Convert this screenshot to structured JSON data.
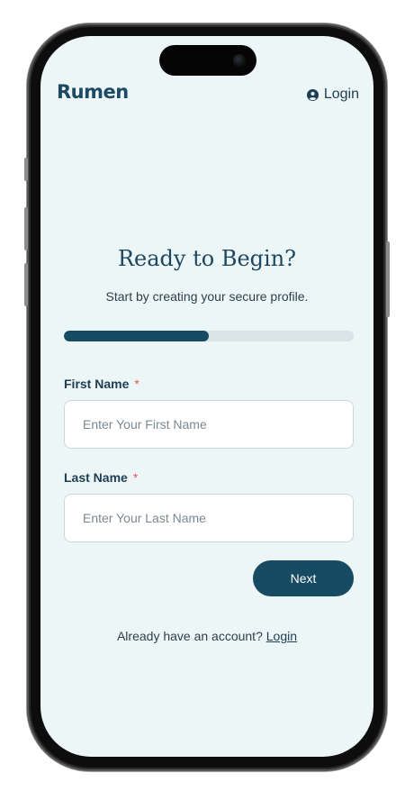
{
  "brand": {
    "logo_text": "Rumen"
  },
  "header": {
    "login_label": "Login"
  },
  "hero": {
    "title": "Ready to Begin?",
    "subtitle": "Start by creating your secure profile."
  },
  "progress": {
    "fraction": 0.5
  },
  "form": {
    "first_name": {
      "label": "First Name",
      "required_mark": "*",
      "placeholder": "Enter Your First Name",
      "value": ""
    },
    "last_name": {
      "label": "Last Name",
      "required_mark": "*",
      "placeholder": "Enter Your Last Name",
      "value": ""
    },
    "next_label": "Next"
  },
  "footer": {
    "prompt": "Already have an account?",
    "login_link": "Login"
  },
  "colors": {
    "primary": "#174a63",
    "background": "#ecf6f7",
    "required": "#e05a4e",
    "track": "#d8e4e6"
  },
  "icons": {
    "header_login": "user-circle-icon"
  }
}
